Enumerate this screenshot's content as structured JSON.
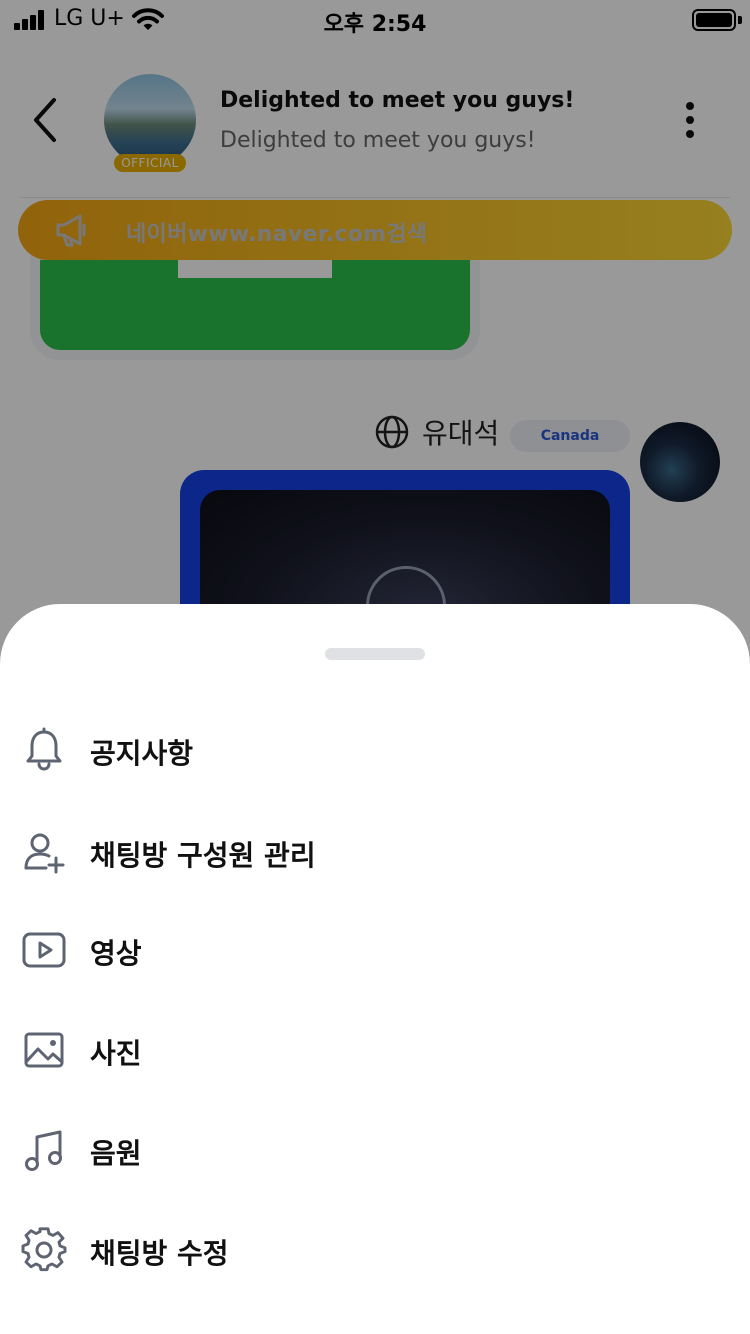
{
  "status_bar": {
    "carrier": "LG U+",
    "time": "오후 2:54"
  },
  "header": {
    "title": "Delighted to meet you guys!",
    "subtitle": "Delighted to meet you guys!",
    "badge": "OFFICIAL",
    "icons": [
      "back-chevron-icon",
      "more-vertical-icon"
    ]
  },
  "notice": {
    "text": "네이버www.naver.com검색",
    "icon": "megaphone-icon"
  },
  "message": {
    "sender": "유대석",
    "country": "Canada",
    "icons": [
      "globe-icon",
      "play-icon"
    ]
  },
  "menu": {
    "items": [
      {
        "label": "공지사항",
        "icon": "bell-icon"
      },
      {
        "label": "채팅방 구성원 관리",
        "icon": "add-user-icon"
      },
      {
        "label": "영상",
        "icon": "video-icon"
      },
      {
        "label": "사진",
        "icon": "image-icon"
      },
      {
        "label": "음원",
        "icon": "music-icon"
      },
      {
        "label": "채팅방 수정",
        "icon": "settings-icon"
      }
    ]
  },
  "colors": {
    "overlay": "rgba(0,0,0,0.40)",
    "notice_bar": "#f7c327",
    "icon_stroke": "#5f6472",
    "video_card": "#1440e6",
    "green_card": "#2cc04a"
  }
}
